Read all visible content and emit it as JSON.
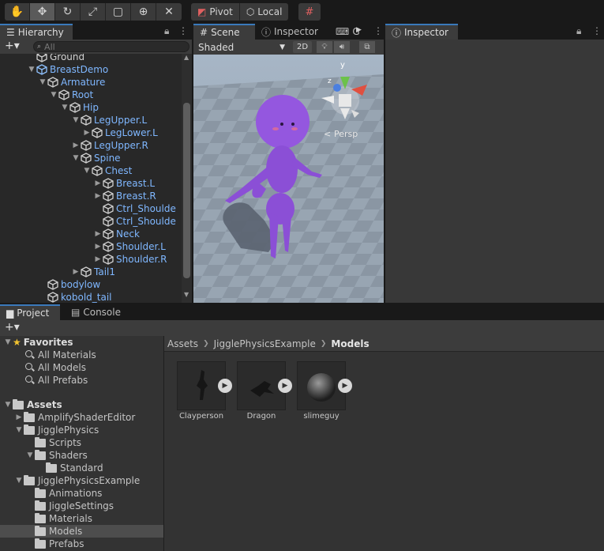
{
  "toolbar": {
    "pivot_label": "Pivot",
    "local_label": "Local"
  },
  "hierarchy": {
    "tab_label": "Hierarchy",
    "search_placeholder": "All",
    "items": [
      {
        "label": "Ground",
        "depth": 0,
        "arrow": "",
        "style": "plain"
      },
      {
        "label": "BreastDemo",
        "depth": 0,
        "arrow": "▼",
        "style": "blue"
      },
      {
        "label": "Armature",
        "depth": 1,
        "arrow": "▼",
        "style": "blue"
      },
      {
        "label": "Root",
        "depth": 2,
        "arrow": "▼",
        "style": "blue"
      },
      {
        "label": "Hip",
        "depth": 3,
        "arrow": "▼",
        "style": "blue"
      },
      {
        "label": "LegUpper.L",
        "depth": 4,
        "arrow": "▼",
        "style": "blue"
      },
      {
        "label": "LegLower.L",
        "depth": 5,
        "arrow": "▶",
        "style": "blue"
      },
      {
        "label": "LegUpper.R",
        "depth": 4,
        "arrow": "▶",
        "style": "blue"
      },
      {
        "label": "Spine",
        "depth": 4,
        "arrow": "▼",
        "style": "blue"
      },
      {
        "label": "Chest",
        "depth": 5,
        "arrow": "▼",
        "style": "blue"
      },
      {
        "label": "Breast.L",
        "depth": 6,
        "arrow": "▶",
        "style": "blue"
      },
      {
        "label": "Breast.R",
        "depth": 6,
        "arrow": "▶",
        "style": "blue"
      },
      {
        "label": "Ctrl_Shoulde",
        "depth": 6,
        "arrow": "",
        "style": "blue"
      },
      {
        "label": "Ctrl_Shoulde",
        "depth": 6,
        "arrow": "",
        "style": "blue"
      },
      {
        "label": "Neck",
        "depth": 6,
        "arrow": "▶",
        "style": "blue"
      },
      {
        "label": "Shoulder.L",
        "depth": 6,
        "arrow": "▶",
        "style": "blue"
      },
      {
        "label": "Shoulder.R",
        "depth": 6,
        "arrow": "▶",
        "style": "blue"
      },
      {
        "label": "Tail1",
        "depth": 4,
        "arrow": "▶",
        "style": "blue"
      },
      {
        "label": "bodylow",
        "depth": 1,
        "arrow": "",
        "style": "blue"
      },
      {
        "label": "kobold_tail",
        "depth": 1,
        "arrow": "",
        "style": "blue"
      }
    ]
  },
  "scene": {
    "tab_scene": "Scene",
    "tab_inspector": "Inspector",
    "tab_game": "G",
    "shading_mode": "Shaded",
    "mode_2d": "2D",
    "gizmo_axis_y": "y",
    "gizmo_axis_z": "z",
    "persp_label": "Persp"
  },
  "inspector": {
    "tab_label": "Inspector"
  },
  "project": {
    "tab_project": "Project",
    "tab_console": "Console",
    "favorites_label": "Favorites",
    "favorites": [
      "All Materials",
      "All Models",
      "All Prefabs"
    ],
    "assets_label": "Assets",
    "tree": [
      {
        "label": "AmplifyShaderEditor",
        "depth": 1,
        "arrow": "▶"
      },
      {
        "label": "JigglePhysics",
        "depth": 1,
        "arrow": "▼"
      },
      {
        "label": "Scripts",
        "depth": 2,
        "arrow": ""
      },
      {
        "label": "Shaders",
        "depth": 2,
        "arrow": "▼"
      },
      {
        "label": "Standard",
        "depth": 3,
        "arrow": ""
      },
      {
        "label": "JigglePhysicsExample",
        "depth": 1,
        "arrow": "▼"
      },
      {
        "label": "Animations",
        "depth": 2,
        "arrow": ""
      },
      {
        "label": "JiggleSettings",
        "depth": 2,
        "arrow": ""
      },
      {
        "label": "Materials",
        "depth": 2,
        "arrow": ""
      },
      {
        "label": "Models",
        "depth": 2,
        "arrow": ""
      },
      {
        "label": "Prefabs",
        "depth": 2,
        "arrow": ""
      }
    ],
    "breadcrumb": [
      "Assets",
      "JigglePhysicsExample",
      "Models"
    ],
    "assets": [
      {
        "label": "Clayperson",
        "thumb": "clayperson-figure"
      },
      {
        "label": "Dragon",
        "thumb": "dragon-figure"
      },
      {
        "label": "slimeguy",
        "thumb": "sphere"
      }
    ]
  }
}
